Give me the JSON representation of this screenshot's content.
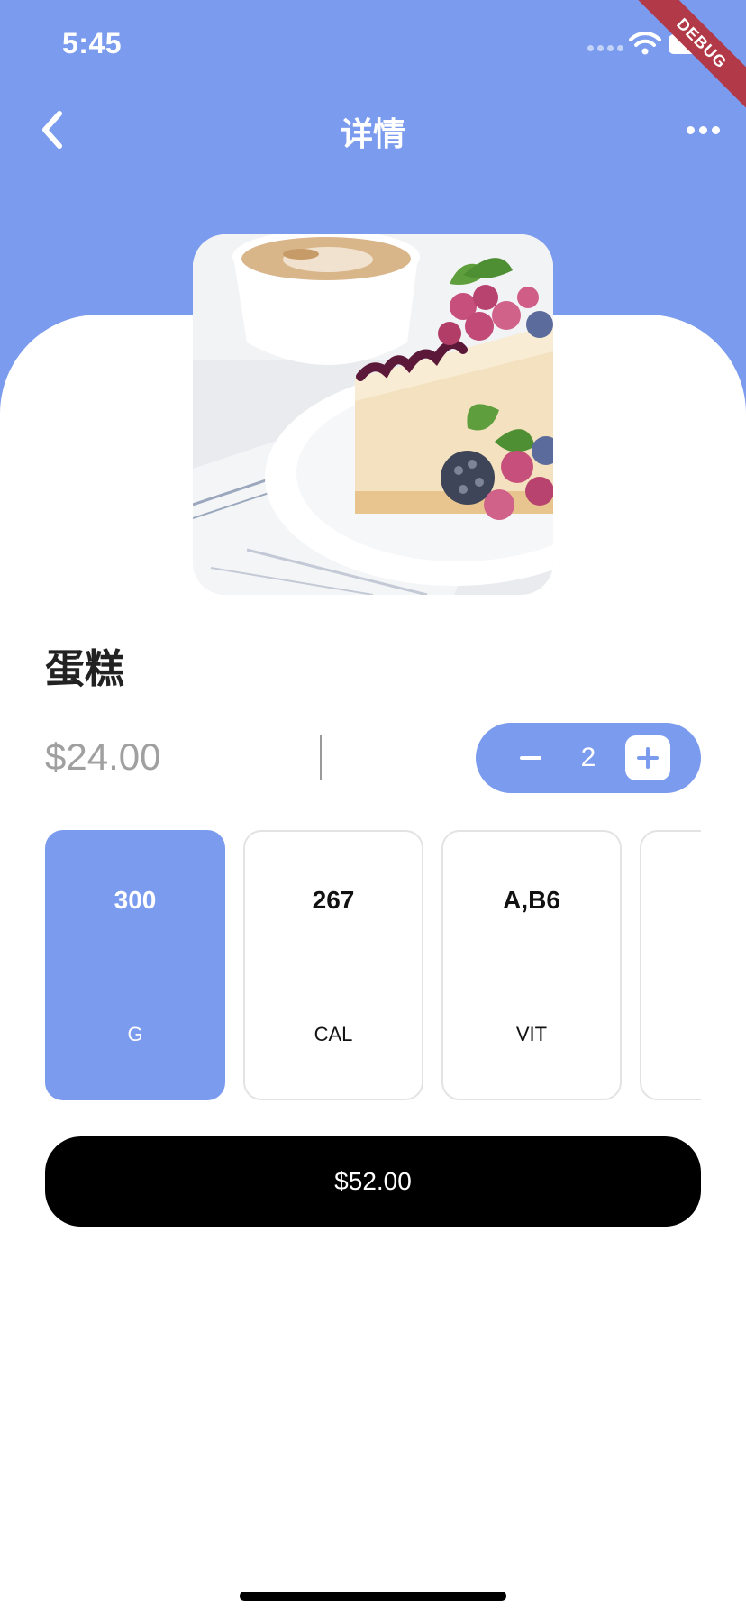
{
  "status_bar": {
    "time": "5:45"
  },
  "debug_banner": {
    "label": "DEBUG"
  },
  "header": {
    "title": "详情"
  },
  "product": {
    "name": "蛋糕",
    "price": "$24.00",
    "image_alt": "cheesecake-with-berries-and-coffee"
  },
  "stepper": {
    "quantity": "2"
  },
  "nutrition": [
    {
      "value": "300",
      "unit": "G",
      "selected": true
    },
    {
      "value": "267",
      "unit": "CAL",
      "selected": false
    },
    {
      "value": "A,B6",
      "unit": "VIT",
      "selected": false
    },
    {
      "value": "",
      "unit": "",
      "selected": false
    }
  ],
  "checkout": {
    "label": "$52.00"
  },
  "colors": {
    "accent": "#7b9bee",
    "checkout_bg": "#000000",
    "text_muted": "#a0a0a0"
  }
}
